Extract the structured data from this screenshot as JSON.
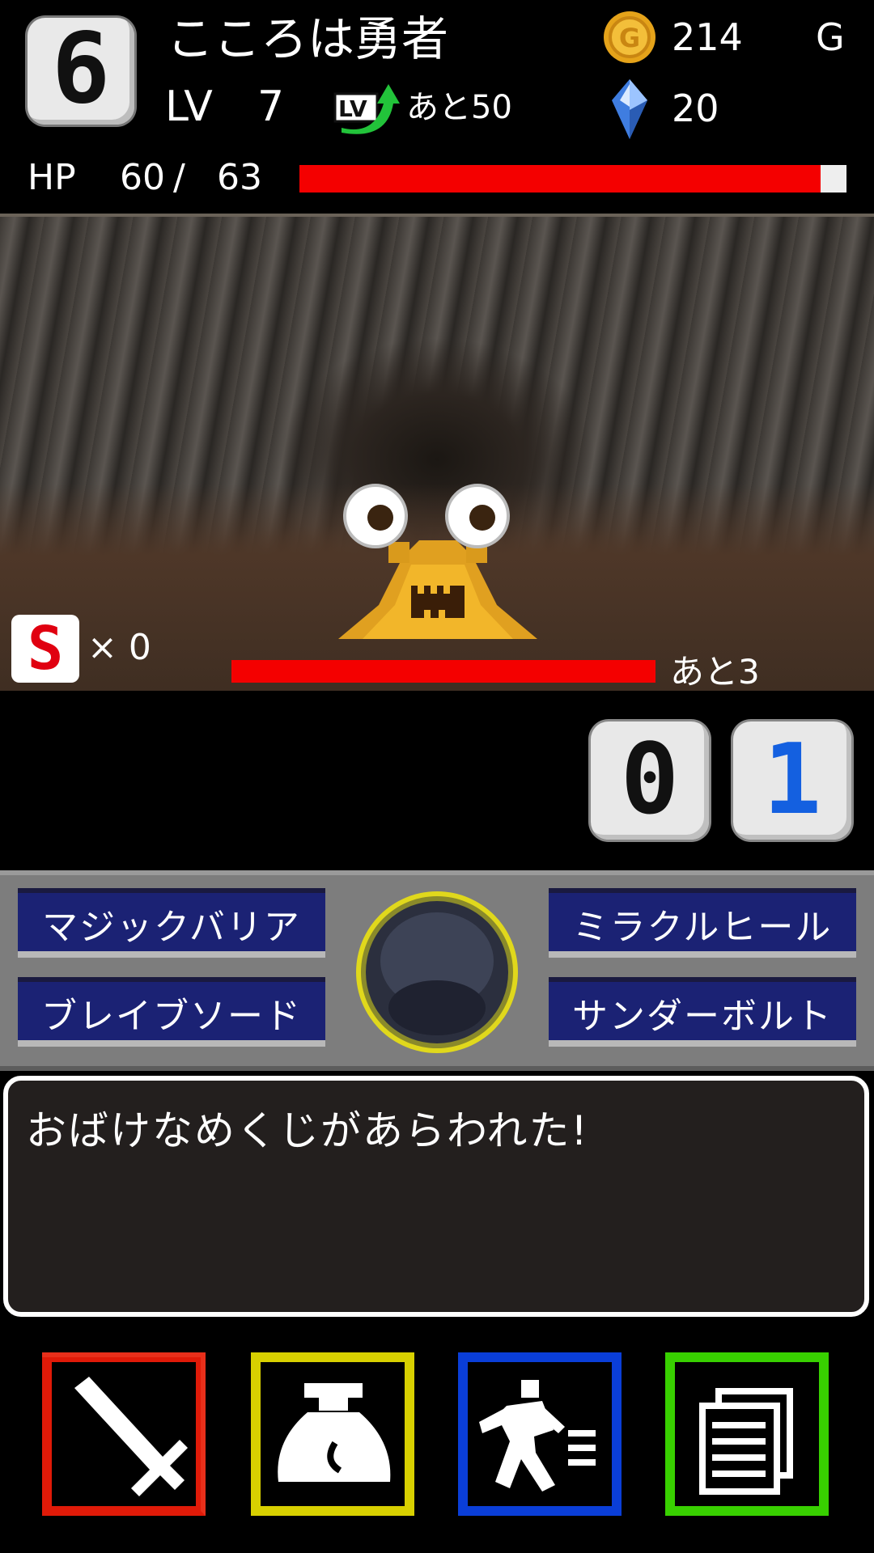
{
  "header": {
    "floor_number": "6",
    "hero_name": "こころは勇者",
    "level_label": "LV",
    "level_value": "7",
    "exp_remaining": "あと50",
    "gold_value": "214",
    "gold_unit": "G",
    "gem_value": "20",
    "hp_label": "HP",
    "hp_current": "60",
    "hp_separator": "/",
    "hp_max": "63",
    "hp_fraction": 0.953
  },
  "battle": {
    "enemy_name_icon": "ghost-slug-icon",
    "special_badge": "S",
    "special_count": "× 0",
    "enemy_hp_fraction": 1.0,
    "enemy_remaining": "あと3"
  },
  "counter": {
    "digit_1": "0",
    "digit_2": "1"
  },
  "skills": {
    "magic_barrier": "マジックバリア",
    "miracle_heal": "ミラクルヒール",
    "brave_sword": "ブレイブソード",
    "thunderbolt": "サンダーボルト"
  },
  "message": {
    "text": "おばけなめくじがあらわれた!"
  },
  "commands": [
    {
      "name": "attack",
      "icon": "sword-icon",
      "color": "#e01a08"
    },
    {
      "name": "item",
      "icon": "bag-icon",
      "color": "#d8d000"
    },
    {
      "name": "escape",
      "icon": "run-icon",
      "color": "#0a3ed8"
    },
    {
      "name": "log",
      "icon": "document-icon",
      "color": "#38d000"
    }
  ],
  "colors": {
    "hp_bar": "#f40000",
    "skill_button": "#1b2274",
    "counter_blue": "#1460e0"
  }
}
